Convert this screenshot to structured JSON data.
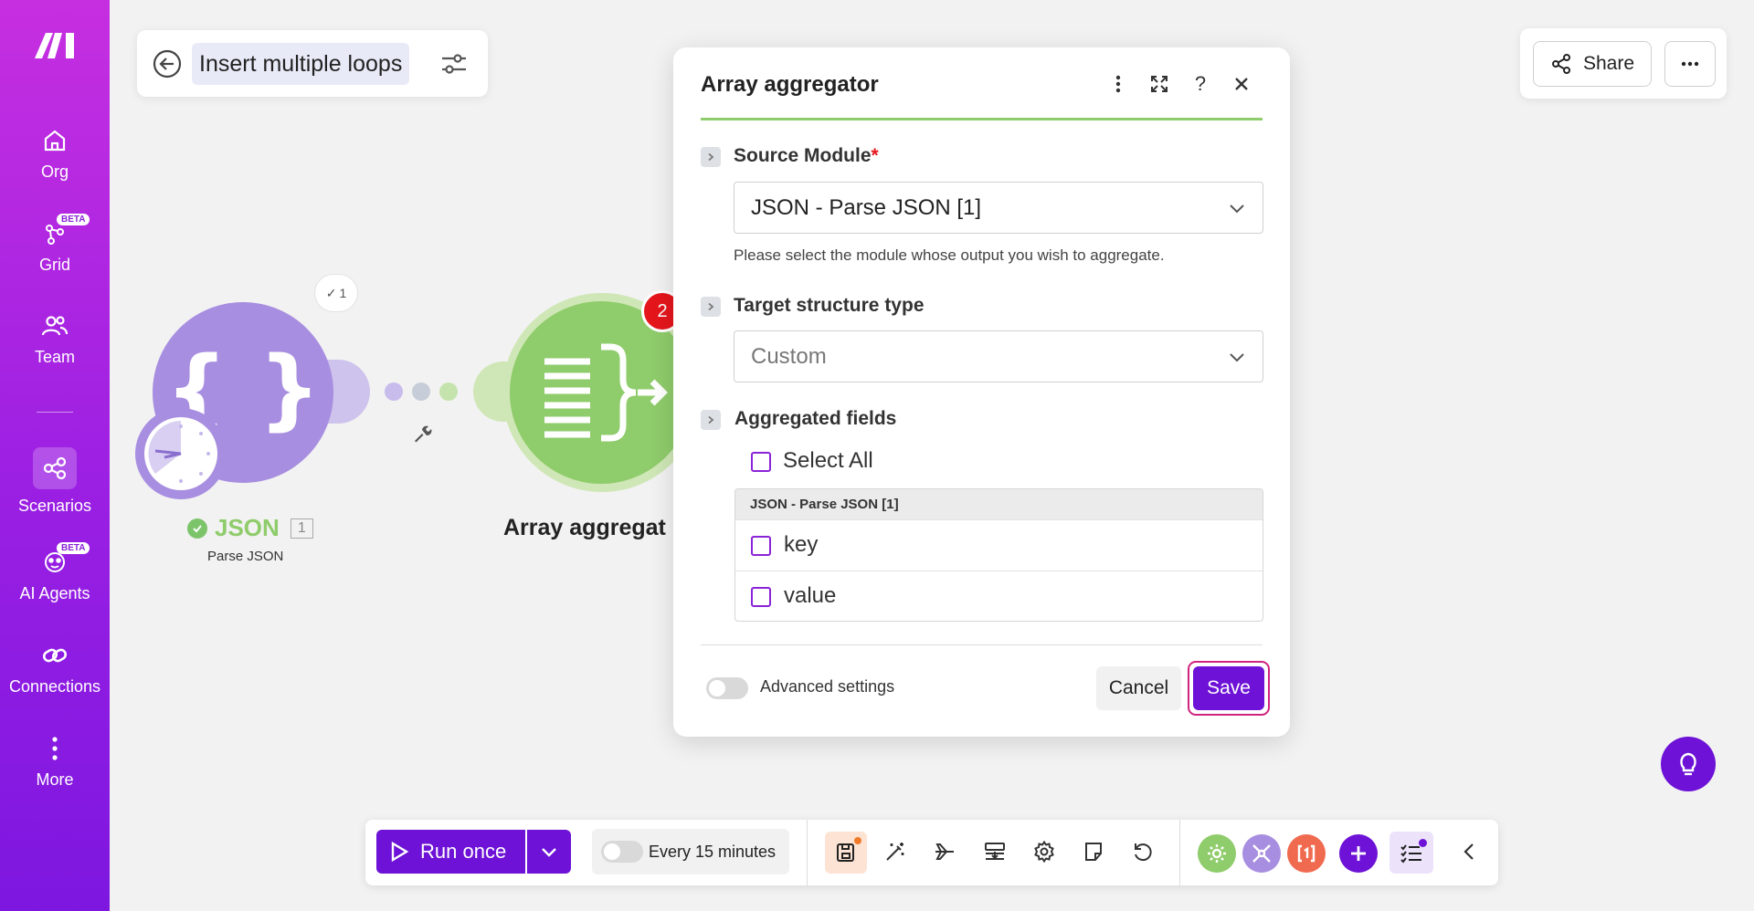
{
  "sidebar": {
    "items": [
      {
        "label": "Org",
        "icon": "home-icon"
      },
      {
        "label": "Grid",
        "icon": "grid-nodes-icon",
        "badge": "BETA"
      },
      {
        "label": "Team",
        "icon": "team-icon"
      },
      {
        "label": "Scenarios",
        "icon": "scenarios-icon",
        "active": true
      },
      {
        "label": "AI Agents",
        "icon": "ai-agents-icon",
        "badge": "BETA"
      },
      {
        "label": "Connections",
        "icon": "link-icon"
      },
      {
        "label": "More",
        "icon": "vertical-dots-icon"
      }
    ]
  },
  "scenario": {
    "title": "Insert multiple loops"
  },
  "topbar": {
    "share_label": "Share"
  },
  "canvas": {
    "json_module": {
      "name": "JSON",
      "index": "1",
      "subtitle": "Parse JSON",
      "run_badge": "1"
    },
    "aggregator_module": {
      "name": "Array aggregat",
      "badge": "2"
    }
  },
  "dialog": {
    "title": "Array aggregator",
    "source_module": {
      "label": "Source Module",
      "required_mark": "*",
      "value": "JSON - Parse JSON [1]",
      "help": "Please select the module whose output you wish to aggregate."
    },
    "target_structure": {
      "label": "Target structure type",
      "value": "Custom"
    },
    "aggregated_fields": {
      "label": "Aggregated fields",
      "select_all": "Select All",
      "group": "JSON - Parse JSON [1]",
      "fields": [
        "key",
        "value"
      ]
    },
    "advanced_label": "Advanced settings",
    "cancel_label": "Cancel",
    "save_label": "Save"
  },
  "toolbar": {
    "run_label": "Run once",
    "schedule_label": "Every 15 minutes"
  },
  "colors": {
    "sidebar_top": "#c62fe0",
    "sidebar_bottom": "#7d17e0",
    "primary": "#6d12d6",
    "json_module": "#a88ee0",
    "aggregator_module": "#8fcc6b",
    "error_badge": "#e5161c"
  }
}
